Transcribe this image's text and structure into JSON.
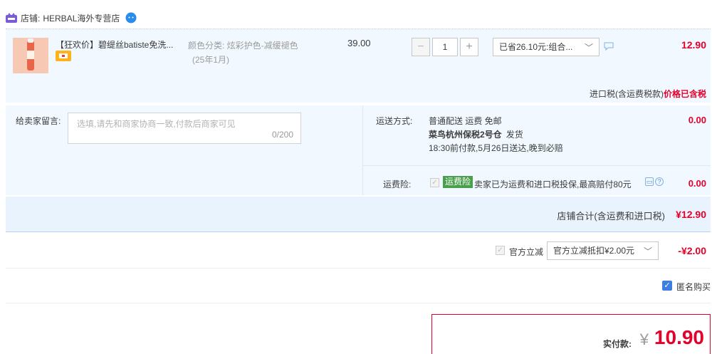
{
  "shop": {
    "label": "店铺:",
    "name": "HERBAL海外专营店",
    "badge_icon": "tmall-shop-icon",
    "contact_icon": "wangwang-chat-icon"
  },
  "item": {
    "title": "【狂欢价】碧缇丝batiste免洗...",
    "sku_line1": "颜色分类:  炫彩护色-减缓褪色",
    "sku_line2": "(25年1月)",
    "unit_price": "39.00",
    "quantity": "1",
    "qty_minus": "−",
    "qty_plus": "+",
    "discount_option": "已省26.10元:组合...",
    "total": "12.90",
    "tax_label": "进口税(含运费税款)",
    "tax_value": "价格已含税"
  },
  "memo": {
    "label": "给卖家留言:",
    "placeholder": "选填,请先和商家协商一致,付款后商家可见",
    "count": "0/200"
  },
  "shipping": {
    "label": "运送方式:",
    "method": "普通配送 运费 免邮",
    "warehouse": "菜鸟杭州保税2号仓",
    "warehouse_note": "发货",
    "eta": "18:30前付款,5月26日送达,晚到必赔",
    "amount": "0.00"
  },
  "insurance": {
    "label": "运费险:",
    "tag": "运费险",
    "desc": "卖家已为运费和进口税投保,最高赔付80元",
    "amount": "0.00"
  },
  "subtotal": {
    "label": "店铺合计(含运费和进口税)",
    "value": "¥12.90"
  },
  "official": {
    "label": "官方立减",
    "option": "官方立减抵扣¥2.00元",
    "amount": "-¥2.00"
  },
  "anonymous": {
    "label": "匿名购买",
    "checked": true
  },
  "payment": {
    "label": "实付款:",
    "currency": "¥",
    "amount": "10.90"
  },
  "colors": {
    "accent_red": "#e4002b",
    "panel_blue": "#f1f8ff",
    "check_blue": "#3d7ee0",
    "insurance_green": "#4aa04a"
  }
}
